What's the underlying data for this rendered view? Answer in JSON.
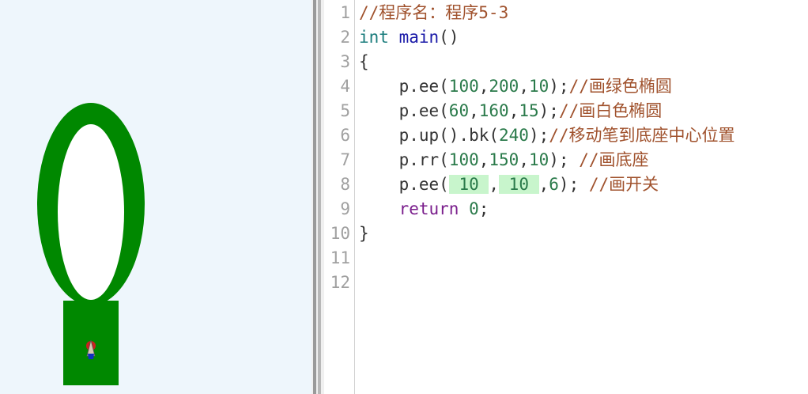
{
  "canvas": {
    "colors": {
      "background": "#eef6fc",
      "green": "#008800",
      "white": "#ffffff",
      "pen_red": "#cc2020",
      "pen_blue": "#1030c0"
    },
    "drawing": [
      "green-ellipse",
      "white-ellipse",
      "green-base",
      "turtle-pen"
    ]
  },
  "editor": {
    "lines": [
      {
        "n": "1",
        "tokens": [
          {
            "t": "//程序名：程序5-3",
            "c": "cmt"
          }
        ]
      },
      {
        "n": "2",
        "tokens": [
          {
            "t": "int",
            "c": "kw-type"
          },
          {
            "t": " "
          },
          {
            "t": "main",
            "c": "kw-fn"
          },
          {
            "t": "()"
          }
        ]
      },
      {
        "n": "3",
        "tokens": [
          {
            "t": "{"
          }
        ]
      },
      {
        "n": "4",
        "tokens": [
          {
            "t": "    p.ee("
          },
          {
            "t": "100",
            "c": "num"
          },
          {
            "t": ","
          },
          {
            "t": "200",
            "c": "num"
          },
          {
            "t": ","
          },
          {
            "t": "10",
            "c": "num"
          },
          {
            "t": ");"
          },
          {
            "t": "//画绿色椭圆",
            "c": "cmt"
          }
        ]
      },
      {
        "n": "5",
        "tokens": [
          {
            "t": "    p.ee("
          },
          {
            "t": "60",
            "c": "num"
          },
          {
            "t": ","
          },
          {
            "t": "160",
            "c": "num"
          },
          {
            "t": ","
          },
          {
            "t": "15",
            "c": "num"
          },
          {
            "t": ");"
          },
          {
            "t": "//画白色椭圆",
            "c": "cmt"
          }
        ]
      },
      {
        "n": "6",
        "tokens": [
          {
            "t": "    p.up().bk("
          },
          {
            "t": "240",
            "c": "num"
          },
          {
            "t": ");"
          },
          {
            "t": "//移动笔到底座中心位置",
            "c": "cmt"
          }
        ]
      },
      {
        "n": "7",
        "tokens": [
          {
            "t": "    p.rr("
          },
          {
            "t": "100",
            "c": "num"
          },
          {
            "t": ","
          },
          {
            "t": "150",
            "c": "num"
          },
          {
            "t": ","
          },
          {
            "t": "10",
            "c": "num"
          },
          {
            "t": "); "
          },
          {
            "t": "//画底座",
            "c": "cmt"
          }
        ]
      },
      {
        "n": "8",
        "tokens": [
          {
            "t": "    p.ee("
          },
          {
            "t": " 10 ",
            "c": "num hl"
          },
          {
            "t": ","
          },
          {
            "t": " 10 ",
            "c": "num hl"
          },
          {
            "t": ","
          },
          {
            "t": "6",
            "c": "num"
          },
          {
            "t": "); "
          },
          {
            "t": "//画开关",
            "c": "cmt"
          }
        ]
      },
      {
        "n": "9",
        "tokens": [
          {
            "t": "    "
          },
          {
            "t": "return",
            "c": "kw-ret"
          },
          {
            "t": " "
          },
          {
            "t": "0",
            "c": "num"
          },
          {
            "t": ";"
          }
        ]
      },
      {
        "n": "10",
        "tokens": [
          {
            "t": "}"
          }
        ]
      },
      {
        "n": "11",
        "tokens": []
      },
      {
        "n": "12",
        "tokens": []
      }
    ]
  }
}
